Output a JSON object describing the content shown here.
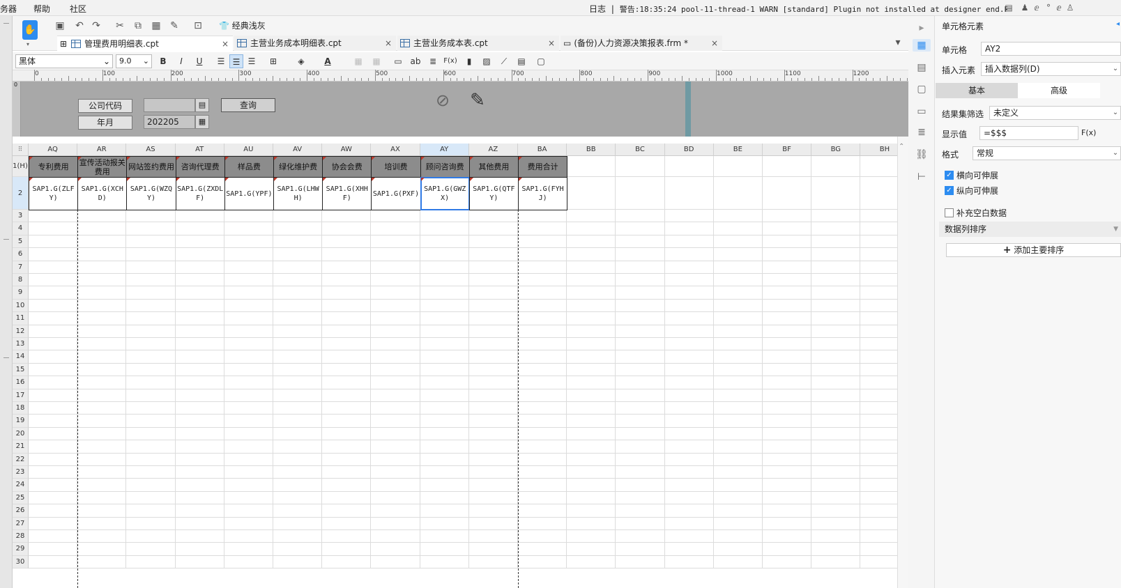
{
  "menu": [
    "务器",
    "帮助",
    "社区"
  ],
  "log": {
    "label": "日志",
    "warning": "警告:18:35:24 pool-11-thread-1 WARN [standard] Plugin not installed at designer end.Plugin..."
  },
  "toolbar": {
    "theme_label": "经典浅灰",
    "app_caret": "▾"
  },
  "tabs": [
    {
      "label": "管理费用明细表.cpt",
      "close": "×"
    },
    {
      "label": "主营业务成本明细表.cpt",
      "close": "×"
    },
    {
      "label": "主营业务成本表.cpt",
      "close": "×"
    },
    {
      "label": "(备份)人力资源决策报表.frm *",
      "close": "×"
    }
  ],
  "format": {
    "font_name": "黑体",
    "font_size": "9.0",
    "bold": "B",
    "italic": "I",
    "underline": "U"
  },
  "ruler": [
    "0",
    "100",
    "200",
    "300",
    "400",
    "500",
    "600",
    "700",
    "800",
    "900",
    "1000",
    "1100",
    "1200"
  ],
  "params": {
    "company_label": "公司代码",
    "company_value": "",
    "month_label": "年月",
    "month_value": "202205",
    "query_label": "查询"
  },
  "sheet": {
    "corner": "⠿",
    "columns": [
      "AQ",
      "AR",
      "AS",
      "AT",
      "AU",
      "AV",
      "AW",
      "AX",
      "AY",
      "AZ",
      "BA",
      "BB",
      "BC",
      "BD",
      "BE",
      "BF",
      "BG",
      "BH"
    ],
    "selected_column": "AY",
    "rows": [
      "1(H)",
      "2",
      "3",
      "4",
      "5",
      "6",
      "7",
      "8",
      "9",
      "10",
      "11",
      "12",
      "13",
      "14",
      "15",
      "16",
      "17",
      "18",
      "19",
      "20",
      "21",
      "22",
      "23",
      "24",
      "25",
      "26",
      "27",
      "28",
      "29",
      "30"
    ],
    "headers": [
      "专利费用",
      "宣传活动报关费用",
      "网站签约费用",
      "咨询代理费",
      "样品费",
      "绿化维护费",
      "协会会费",
      "培训费",
      "顾问咨询费",
      "其他费用",
      "费用合计"
    ],
    "cells": [
      "SAP1.G(ZLFY)",
      "SAP1.G(XCHD)",
      "SAP1.G(WZQY)",
      "SAP1.G(ZXDLF)",
      "SAP1.G(YPF)",
      "SAP1.G(LHWH)",
      "SAP1.G(XHHF)",
      "SAP1.G(PXF)",
      "SAP1.G(GWZX)",
      "SAP1.G(QTFY)",
      "SAP1.G(FYHJ)"
    ],
    "selected_cell": "AY2"
  },
  "props": {
    "title": "单元格元素",
    "cell_label": "单元格",
    "cell_value": "AY2",
    "insert_label": "插入元素",
    "insert_value": "插入数据列(D)",
    "tab_basic": "基本",
    "tab_advanced": "高级",
    "filter_label": "结果集筛选",
    "filter_value": "未定义",
    "display_label": "显示值",
    "display_value": "=$$$",
    "display_fx": "F(x)",
    "format_label": "格式",
    "format_value": "常规",
    "chk_horizontal": "横向可伸展",
    "chk_vertical": "纵向可伸展",
    "chk_fill": "补充空白数据",
    "sort_section": "数据列排序",
    "add_sort": "添加主要排序"
  },
  "colors": {
    "accent": "#2d8cf0",
    "header_fill": "#8c8c8c",
    "param_bg": "#a8a8a8"
  }
}
